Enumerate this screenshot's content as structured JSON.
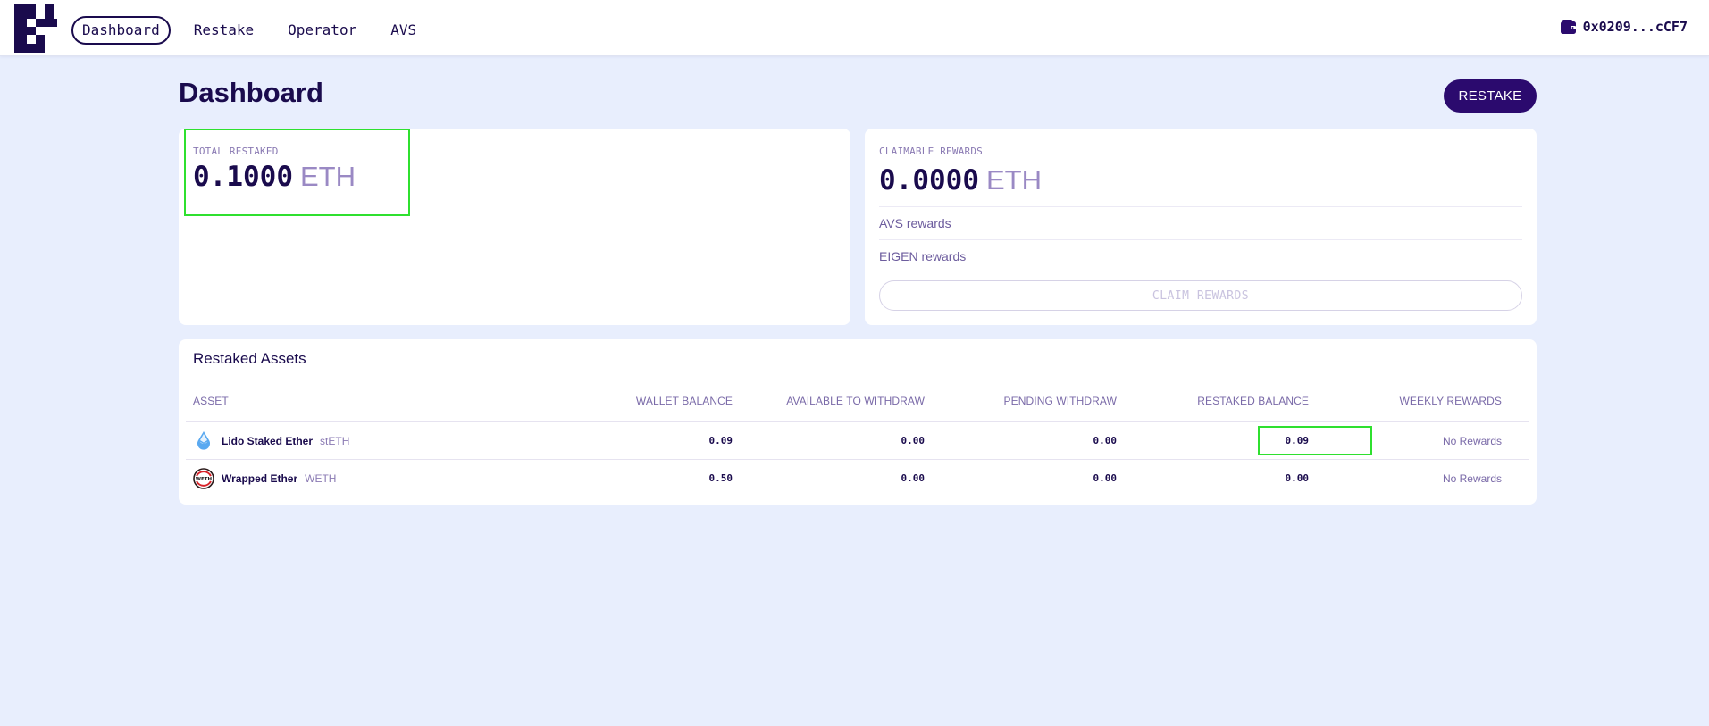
{
  "nav": {
    "items": [
      {
        "label": "Dashboard",
        "active": true
      },
      {
        "label": "Restake",
        "active": false
      },
      {
        "label": "Operator",
        "active": false
      },
      {
        "label": "AVS",
        "active": false
      }
    ]
  },
  "wallet": {
    "address": "0x0209...cCF7",
    "icon": "wallet-icon"
  },
  "page": {
    "title": "Dashboard",
    "restake_label": "RESTAKE"
  },
  "total": {
    "label": "TOTAL RESTAKED",
    "amount": "0.1000",
    "unit": "ETH"
  },
  "rewards": {
    "label": "CLAIMABLE REWARDS",
    "amount": "0.0000",
    "unit": "ETH",
    "avs_label": "AVS rewards",
    "eigen_label": "EIGEN rewards",
    "claim_label": "CLAIM REWARDS"
  },
  "assets": {
    "title": "Restaked Assets",
    "headers": [
      "ASSET",
      "WALLET BALANCE",
      "AVAILABLE TO WITHDRAW",
      "PENDING WITHDRAW",
      "RESTAKED BALANCE",
      "WEEKLY REWARDS"
    ],
    "rows": [
      {
        "name": "Lido Staked Ether",
        "symbol": "stETH",
        "icon": "steth-icon",
        "wallet": "0.09",
        "available": "0.00",
        "pending": "0.00",
        "restaked": "0.09",
        "rewards": "No Rewards"
      },
      {
        "name": "Wrapped Ether",
        "symbol": "WETH",
        "icon": "weth-icon",
        "wallet": "0.50",
        "available": "0.00",
        "pending": "0.00",
        "restaked": "0.00",
        "rewards": "No Rewards"
      }
    ]
  },
  "colors": {
    "brand": "#1a0b4d",
    "button": "#2b0a6e",
    "background": "#e8eefd",
    "highlight": "#2fe02f"
  }
}
